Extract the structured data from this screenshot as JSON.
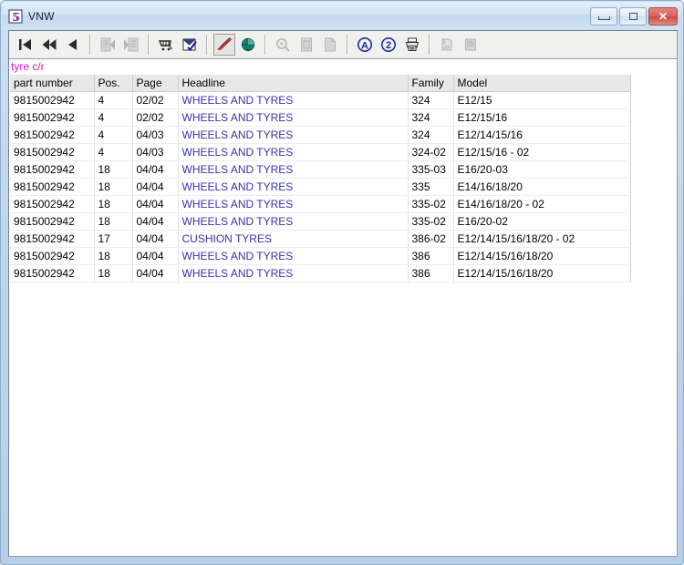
{
  "window": {
    "title": "VNW",
    "app_icon": "vnw-logo-icon",
    "controls": {
      "minimize": "minimize-button",
      "maximize": "maximize-button",
      "close": "close-button",
      "close_label": "✕"
    }
  },
  "toolbar": {
    "buttons": [
      {
        "name": "first-record-icon",
        "glyph": "go-first",
        "state": "enabled"
      },
      {
        "name": "fast-rewind-icon",
        "glyph": "go-fast-back",
        "state": "enabled"
      },
      {
        "name": "previous-record-icon",
        "glyph": "go-back",
        "state": "enabled"
      },
      {
        "name": "separator",
        "glyph": "sep",
        "state": "sep"
      },
      {
        "name": "document-first-icon",
        "glyph": "doc-left",
        "state": "disabled"
      },
      {
        "name": "document-next-icon",
        "glyph": "doc-right",
        "state": "disabled"
      },
      {
        "name": "separator",
        "glyph": "sep",
        "state": "sep"
      },
      {
        "name": "shopping-cart-icon",
        "glyph": "cart",
        "state": "enabled"
      },
      {
        "name": "order-checklist-icon",
        "glyph": "checklist",
        "state": "enabled"
      },
      {
        "name": "separator",
        "glyph": "sep",
        "state": "sep"
      },
      {
        "name": "highlight-pen-icon",
        "glyph": "pen",
        "state": "pressed"
      },
      {
        "name": "globe-icon",
        "glyph": "globe",
        "state": "enabled"
      },
      {
        "name": "separator",
        "glyph": "sep",
        "state": "sep"
      },
      {
        "name": "zoom-in-icon",
        "glyph": "magnifier",
        "state": "disabled"
      },
      {
        "name": "page-view-icon",
        "glyph": "page",
        "state": "disabled"
      },
      {
        "name": "page-alt-view-icon",
        "glyph": "page2",
        "state": "disabled"
      },
      {
        "name": "separator",
        "glyph": "sep",
        "state": "sep"
      },
      {
        "name": "annotate-a-icon",
        "glyph": "circle-a",
        "state": "enabled"
      },
      {
        "name": "annotate-2-icon",
        "glyph": "circle-2",
        "state": "enabled"
      },
      {
        "name": "print-icon",
        "glyph": "printer",
        "state": "enabled"
      },
      {
        "name": "separator",
        "glyph": "sep",
        "state": "sep"
      },
      {
        "name": "notes-icon",
        "glyph": "notes",
        "state": "disabled"
      },
      {
        "name": "clipboard-icon",
        "glyph": "clipboard",
        "state": "disabled"
      }
    ]
  },
  "search": {
    "term": "tyre c/r"
  },
  "results": {
    "columns": [
      {
        "label": "part number",
        "key": "part",
        "cls": "col-part"
      },
      {
        "label": "Pos.",
        "key": "pos",
        "cls": "col-pos"
      },
      {
        "label": "Page",
        "key": "page",
        "cls": "col-page"
      },
      {
        "label": "Headline",
        "key": "head",
        "cls": "col-head"
      },
      {
        "label": "Family",
        "key": "family",
        "cls": "col-family"
      },
      {
        "label": "Model",
        "key": "model",
        "cls": "col-model"
      }
    ],
    "rows": [
      {
        "part": "9815002942",
        "pos": "4",
        "page": "02/02",
        "head": "WHEELS AND TYRES",
        "family": "324",
        "model": "E12/15"
      },
      {
        "part": "9815002942",
        "pos": "4",
        "page": "02/02",
        "head": "WHEELS AND TYRES",
        "family": "324",
        "model": "E12/15/16"
      },
      {
        "part": "9815002942",
        "pos": "4",
        "page": "04/03",
        "head": "WHEELS AND TYRES",
        "family": "324",
        "model": "E12/14/15/16"
      },
      {
        "part": "9815002942",
        "pos": "4",
        "page": "04/03",
        "head": "WHEELS AND TYRES",
        "family": "324-02",
        "model": "E12/15/16 - 02"
      },
      {
        "part": "9815002942",
        "pos": "18",
        "page": "04/04",
        "head": "WHEELS AND TYRES",
        "family": "335-03",
        "model": "E16/20-03"
      },
      {
        "part": "9815002942",
        "pos": "18",
        "page": "04/04",
        "head": "WHEELS AND TYRES",
        "family": "335",
        "model": "E14/16/18/20"
      },
      {
        "part": "9815002942",
        "pos": "18",
        "page": "04/04",
        "head": "WHEELS AND TYRES",
        "family": "335-02",
        "model": "E14/16/18/20 - 02"
      },
      {
        "part": "9815002942",
        "pos": "18",
        "page": "04/04",
        "head": "WHEELS AND TYRES",
        "family": "335-02",
        "model": "E16/20-02"
      },
      {
        "part": "9815002942",
        "pos": "17",
        "page": "04/04",
        "head": "CUSHION TYRES",
        "family": "386-02",
        "model": "E12/14/15/16/18/20 - 02"
      },
      {
        "part": "9815002942",
        "pos": "18",
        "page": "04/04",
        "head": "WHEELS AND TYRES",
        "family": "386",
        "model": "E12/14/15/16/18/20"
      },
      {
        "part": "9815002942",
        "pos": "18",
        "page": "04/04",
        "head": "WHEELS AND TYRES",
        "family": "386",
        "model": "E12/14/15/16/18/20"
      }
    ]
  },
  "colors": {
    "headline_link": "#3333b0",
    "search_term": "#d417c0",
    "header_bg": "#e8e8e8",
    "close_button": "#c94a44"
  }
}
